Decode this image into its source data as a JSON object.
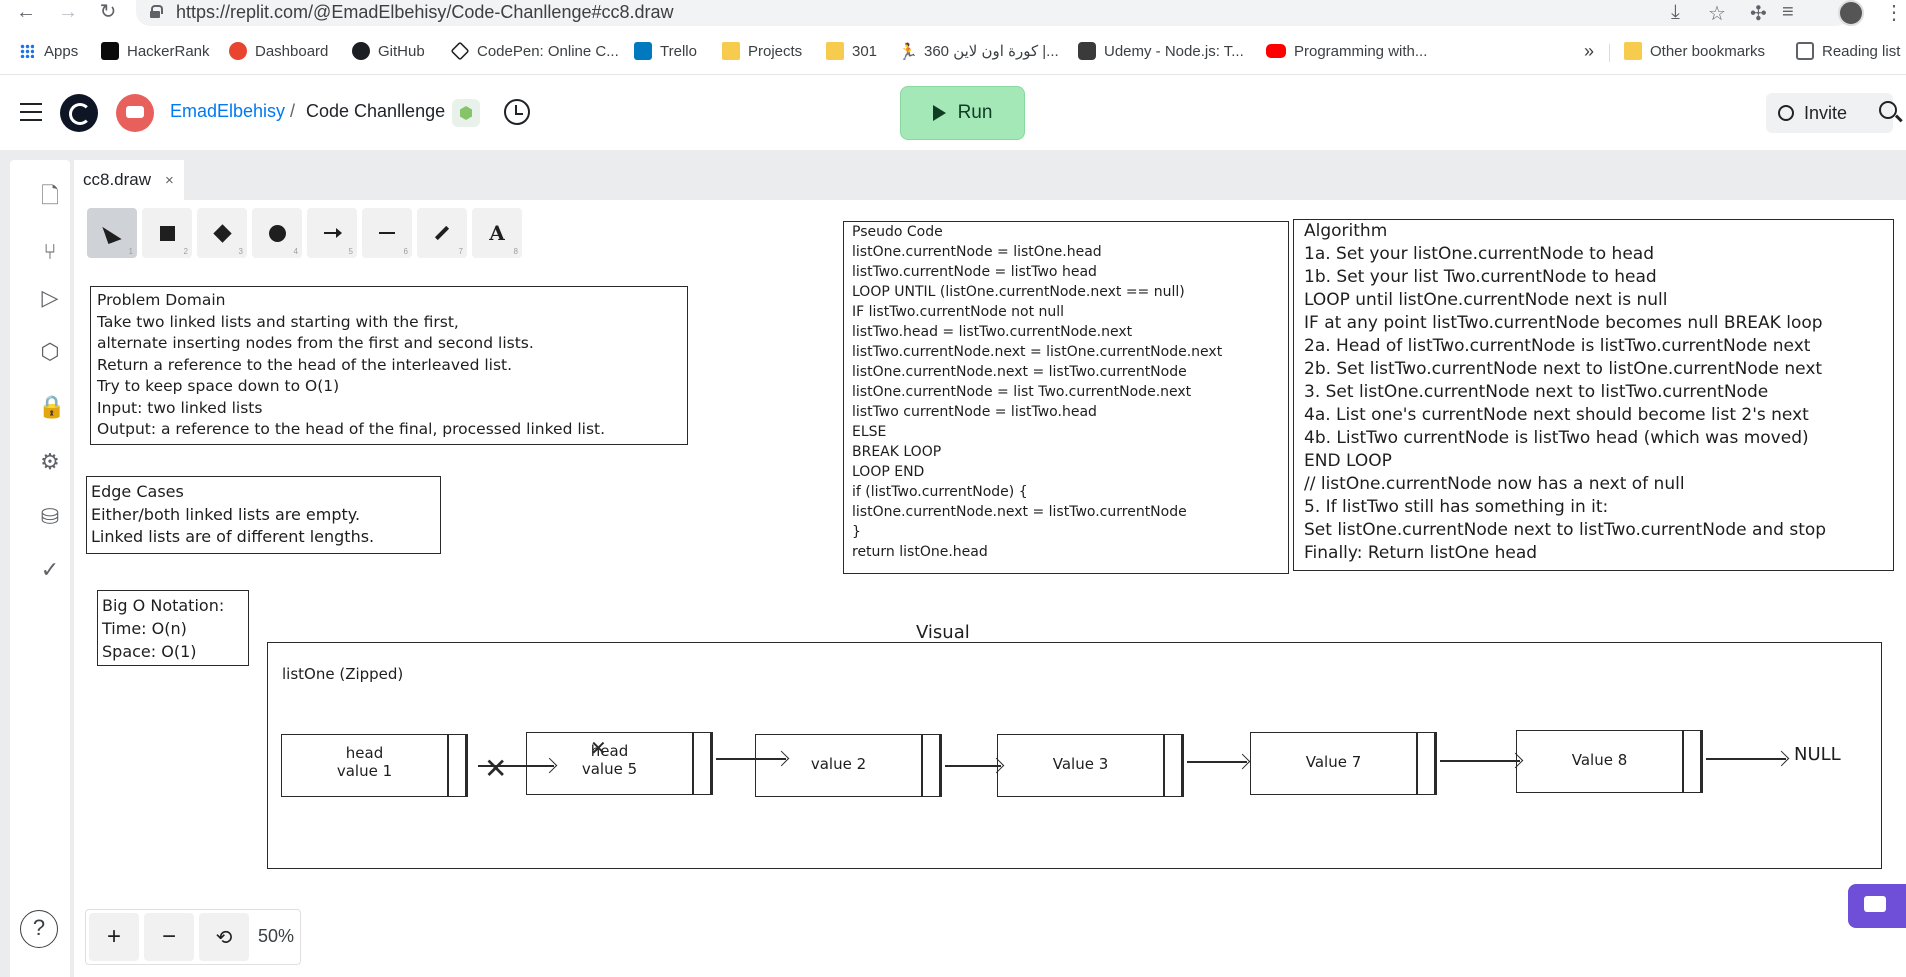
{
  "browser": {
    "url": "https://replit.com/@EmadElbehisy/Code-Chanllenge#cc8.draw",
    "bookmarks": [
      {
        "label": "Apps",
        "icon": "apps-grid-icon"
      },
      {
        "label": "HackerRank",
        "icon": "hackerrank-icon"
      },
      {
        "label": "Dashboard",
        "icon": "dashboard-icon"
      },
      {
        "label": "GitHub",
        "icon": "github-icon"
      },
      {
        "label": "CodePen: Online C...",
        "icon": "codepen-icon"
      },
      {
        "label": "Trello",
        "icon": "trello-icon"
      },
      {
        "label": "Projects",
        "icon": "folder-icon"
      },
      {
        "label": "301",
        "icon": "folder-icon"
      },
      {
        "label": "360 كورة اون لاين |...",
        "icon": "runner-icon"
      },
      {
        "label": "Udemy - Node.js: T...",
        "icon": "udemy-icon"
      },
      {
        "label": "Programming with...",
        "icon": "youtube-icon"
      }
    ],
    "more_label": "»",
    "other_bookmarks": "Other bookmarks",
    "reading_list": "Reading list"
  },
  "header": {
    "username": "EmadElbehisy",
    "separator": "/",
    "repl_name": "Code Chanllenge",
    "run_label": "Run",
    "invite_label": "Invite"
  },
  "editor": {
    "tab_name": "cc8.draw",
    "tab_close": "×",
    "tools": [
      {
        "name": "select",
        "key": "1"
      },
      {
        "name": "rectangle",
        "key": "2"
      },
      {
        "name": "diamond",
        "key": "3"
      },
      {
        "name": "ellipse",
        "key": "4"
      },
      {
        "name": "arrow",
        "key": "5"
      },
      {
        "name": "line",
        "key": "6"
      },
      {
        "name": "draw",
        "key": "7"
      },
      {
        "name": "text",
        "key": "8"
      }
    ],
    "zoom": "50%"
  },
  "drawing": {
    "problem_domain": [
      "Problem Domain",
      "Take two linked lists and starting with the first,",
      "alternate inserting nodes from the first and second lists.",
      "Return a reference to the head of the interleaved list.",
      "Try to keep space down to O(1)",
      "Input: two linked lists",
      "Output: a reference to the head of the final, processed linked list."
    ],
    "edge_cases": [
      "Edge Cases",
      "Either/both linked lists are empty.",
      "Linked lists are of different lengths."
    ],
    "big_o": [
      "Big O Notation:",
      "Time: O(n)",
      "Space: O(1)"
    ],
    "pseudo_code": [
      "Pseudo Code",
      "listOne.currentNode = listOne.head",
      "listTwo.currentNode = listTwo head",
      "LOOP UNTIL (listOne.currentNode.next == null)",
      "IF listTwo.currentNode not null",
      "listTwo.head = listTwo.currentNode.next",
      "listTwo.currentNode.next = listOne.currentNode.next",
      "listOne.currentNode.next = listTwo.currentNode",
      "listOne.currentNode = list Two.currentNode.next",
      "listTwo currentNode = listTwo.head",
      "ELSE",
      "BREAK LOOP",
      "LOOP END",
      "if (listTwo.currentNode) {",
      "listOne.currentNode.next = listTwo.currentNode",
      "}",
      "return listOne.head"
    ],
    "algorithm": [
      "Algorithm",
      "1a. Set your listOne.currentNode to head",
      "1b. Set your list Two.currentNode to head",
      "LOOP until listOne.currentNode next is null",
      "IF at any point listTwo.currentNode becomes null BREAK loop",
      "2a. Head of listTwo.currentNode is listTwo.currentNode next",
      "2b. Set listTwo.currentNode next to listOne.currentNode next",
      "3. Set listOne.currentNode next to listTwo.currentNode",
      "4a. List one's currentNode next should become list 2's next",
      "4b. ListTwo currentNode is listTwo head (which was moved)",
      "END LOOP",
      "// listOne.currentNode now has a next of null",
      "5. If listTwo still has something in it:",
      "Set listOne.currentNode next to listTwo.currentNode and stop",
      "Finally: Return listOne head"
    ],
    "visual_title": "Visual",
    "visual_label": "listOne (Zipped)",
    "nodes": [
      {
        "line1": "head",
        "line2": "value 1"
      },
      {
        "line1": "head",
        "line2": "value 5"
      },
      {
        "line1": "",
        "line2": "value 2"
      },
      {
        "line1": "",
        "line2": "Value 3"
      },
      {
        "line1": "",
        "line2": "Value 7"
      },
      {
        "line1": "",
        "line2": "Value 8"
      }
    ],
    "null_label": "NULL"
  }
}
